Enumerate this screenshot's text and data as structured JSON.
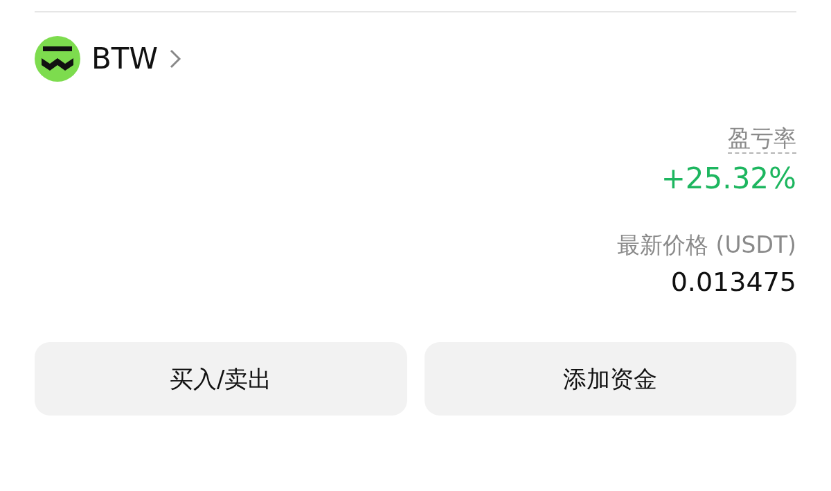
{
  "asset": {
    "symbol": "BTW"
  },
  "stats": [
    {
      "kind": "pnl",
      "label": "盈亏率",
      "value": "+25.32%"
    },
    {
      "kind": "price",
      "label": "最新价格 (USDT)",
      "value": "0.013475"
    }
  ],
  "buttons": [
    "买入/卖出",
    "添加资金"
  ]
}
